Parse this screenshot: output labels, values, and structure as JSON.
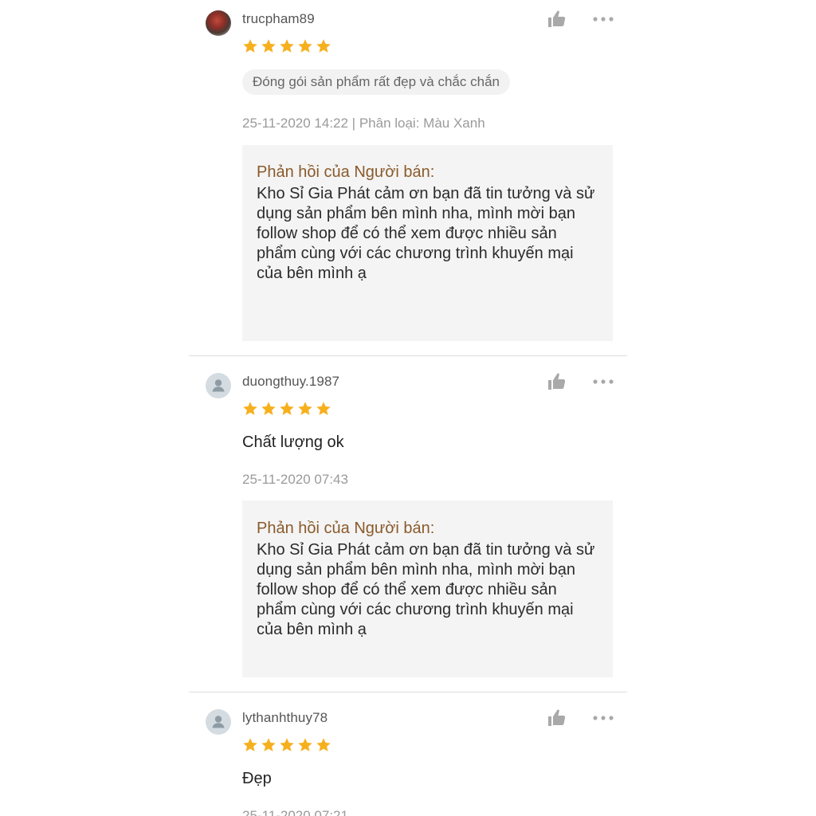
{
  "reviews": [
    {
      "username": "trucpham89",
      "avatar": "user-photo",
      "rating": 5,
      "tag": "Đóng gói sản phẩm rất đẹp và chắc chắn",
      "comment": "",
      "meta": "25-11-2020 14:22 | Phân loại: Màu Xanh",
      "reply_title": "Phản hồi của Người bán:",
      "reply_text": "Kho Sỉ Gia Phát cảm ơn bạn đã tin tưởng và sử dụng sản phẩm bên mình nha, mình mời bạn follow shop để có thể xem được nhiều sản phẩm cùng với các chương trình khuyến mại của bên mình ạ"
    },
    {
      "username": "duongthuy.1987",
      "avatar": "default-user-icon",
      "rating": 5,
      "tag": "",
      "comment": "Chất lượng ok",
      "meta": "25-11-2020 07:43",
      "reply_title": "Phản hồi của Người bán:",
      "reply_text": "Kho Sỉ Gia Phát cảm ơn bạn đã tin tưởng và sử dụng sản phẩm bên mình nha, mình mời bạn follow shop để có thể xem được nhiều sản phẩm cùng với các chương trình khuyến mại của bên mình ạ"
    },
    {
      "username": "lythanhthuy78",
      "avatar": "default-user-icon",
      "rating": 5,
      "tag": "",
      "comment": "Đẹp",
      "meta": "25-11-2020 07:21",
      "reply_title": "",
      "reply_text": ""
    }
  ],
  "icons": {
    "like": "thumbs-up-icon",
    "more": "more-options-icon",
    "star": "star-icon"
  },
  "colors": {
    "star": "#f6b01e",
    "icon_gray": "#a9a9a9",
    "reply_title": "#8a5a2b",
    "reply_bg": "#f4f4f4"
  }
}
